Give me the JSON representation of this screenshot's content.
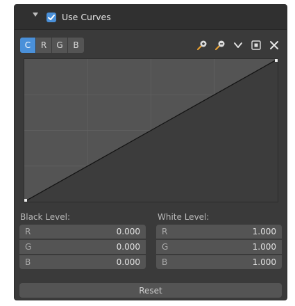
{
  "header": {
    "title": "Use Curves",
    "use_curves_checked": true
  },
  "tabs": [
    {
      "label": "C",
      "active": true
    },
    {
      "label": "R",
      "active": false
    },
    {
      "label": "G",
      "active": false
    },
    {
      "label": "B",
      "active": false
    }
  ],
  "tools": [
    "zoom-in-icon",
    "zoom-out-icon",
    "chevron-down-icon",
    "clipping-icon",
    "close-icon"
  ],
  "curve": {
    "points": [
      [
        0.0,
        0.0
      ],
      [
        1.0,
        1.0
      ]
    ],
    "grid_divisions": 4
  },
  "black_level": {
    "label": "Black Level:",
    "rows": [
      {
        "channel": "R",
        "value": "0.000"
      },
      {
        "channel": "G",
        "value": "0.000"
      },
      {
        "channel": "B",
        "value": "0.000"
      }
    ]
  },
  "white_level": {
    "label": "White Level:",
    "rows": [
      {
        "channel": "R",
        "value": "1.000"
      },
      {
        "channel": "G",
        "value": "1.000"
      },
      {
        "channel": "B",
        "value": "1.000"
      }
    ]
  },
  "reset": {
    "label": "Reset"
  },
  "colors": {
    "accent": "#4a90d9",
    "panel": "#3a3a3a",
    "field": "#545454"
  }
}
